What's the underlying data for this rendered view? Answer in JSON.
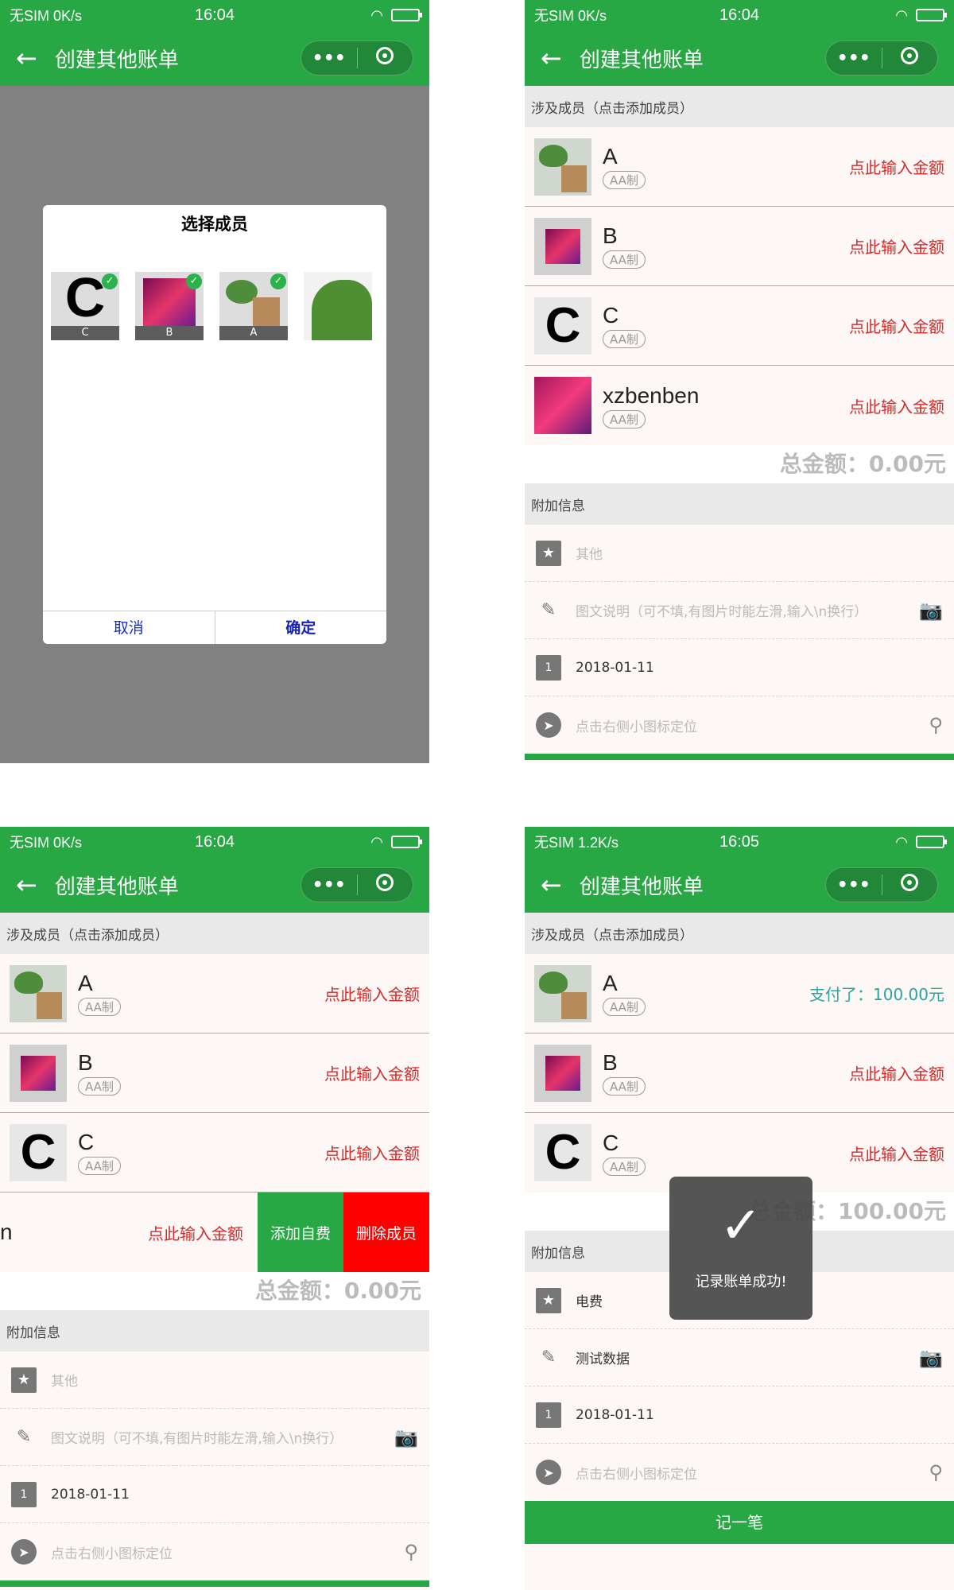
{
  "status": [
    {
      "carrier": "无SIM 0K/s",
      "time": "16:04"
    },
    {
      "carrier": "无SIM 0K/s",
      "time": "16:04"
    },
    {
      "carrier": "无SIM 0K/s",
      "time": "16:04"
    },
    {
      "carrier": "无SIM 1.2K/s",
      "time": "16:05"
    }
  ],
  "nav": {
    "title": "创建其他账单",
    "more": "•••"
  },
  "section_members": "涉及成员（点击添加成员）",
  "section_extra": "附加信息",
  "badge": "AA制",
  "enter_amount": "点此输入金额",
  "modal": {
    "title": "选择成员",
    "cancel": "取消",
    "confirm": "确定",
    "choices": [
      "C",
      "B",
      "A"
    ]
  },
  "panel2": {
    "members": [
      {
        "name": "A",
        "amount": "点此输入金额"
      },
      {
        "name": "B",
        "amount": "点此输入金额"
      },
      {
        "name": "C",
        "amount": "点此输入金额"
      },
      {
        "name": "xzbenben",
        "amount": "点此输入金额"
      }
    ],
    "total": "总金额：0.00元",
    "extra": {
      "type": "其他",
      "note": "图文说明（可不填,有图片时能左滑,输入\\n换行）",
      "date": "2018-01-11",
      "location": "点击右侧小图标定位"
    }
  },
  "panel3": {
    "members": [
      {
        "name": "A",
        "amount": "点此输入金额"
      },
      {
        "name": "B",
        "amount": "点此输入金额"
      },
      {
        "name": "C",
        "amount": "点此输入金额"
      }
    ],
    "swiped": {
      "name_fragment": "n",
      "amount": "点此输入金额",
      "add_fee": "添加自费",
      "remove": "删除成员"
    },
    "total": "总金额：0.00元",
    "extra": {
      "type": "其他",
      "note": "图文说明（可不填,有图片时能左滑,输入\\n换行）",
      "date": "2018-01-11",
      "location": "点击右侧小图标定位"
    }
  },
  "panel4": {
    "members": [
      {
        "name": "A",
        "amount": "支付了：100.00元"
      },
      {
        "name": "B",
        "amount": "点此输入金额"
      },
      {
        "name": "C",
        "amount": "点此输入金额"
      }
    ],
    "total": "总金额：100.00元",
    "extra": {
      "type": "电费",
      "note": "测试数据",
      "date": "2018-01-11",
      "location": "点击右侧小图标定位"
    },
    "submit": "记一笔",
    "toast": "记录账单成功!"
  },
  "colors": {
    "brand": "#28a745",
    "danger": "#ff0000",
    "amount_link": "#d62a2a",
    "amount_paid": "#2aa59f"
  }
}
